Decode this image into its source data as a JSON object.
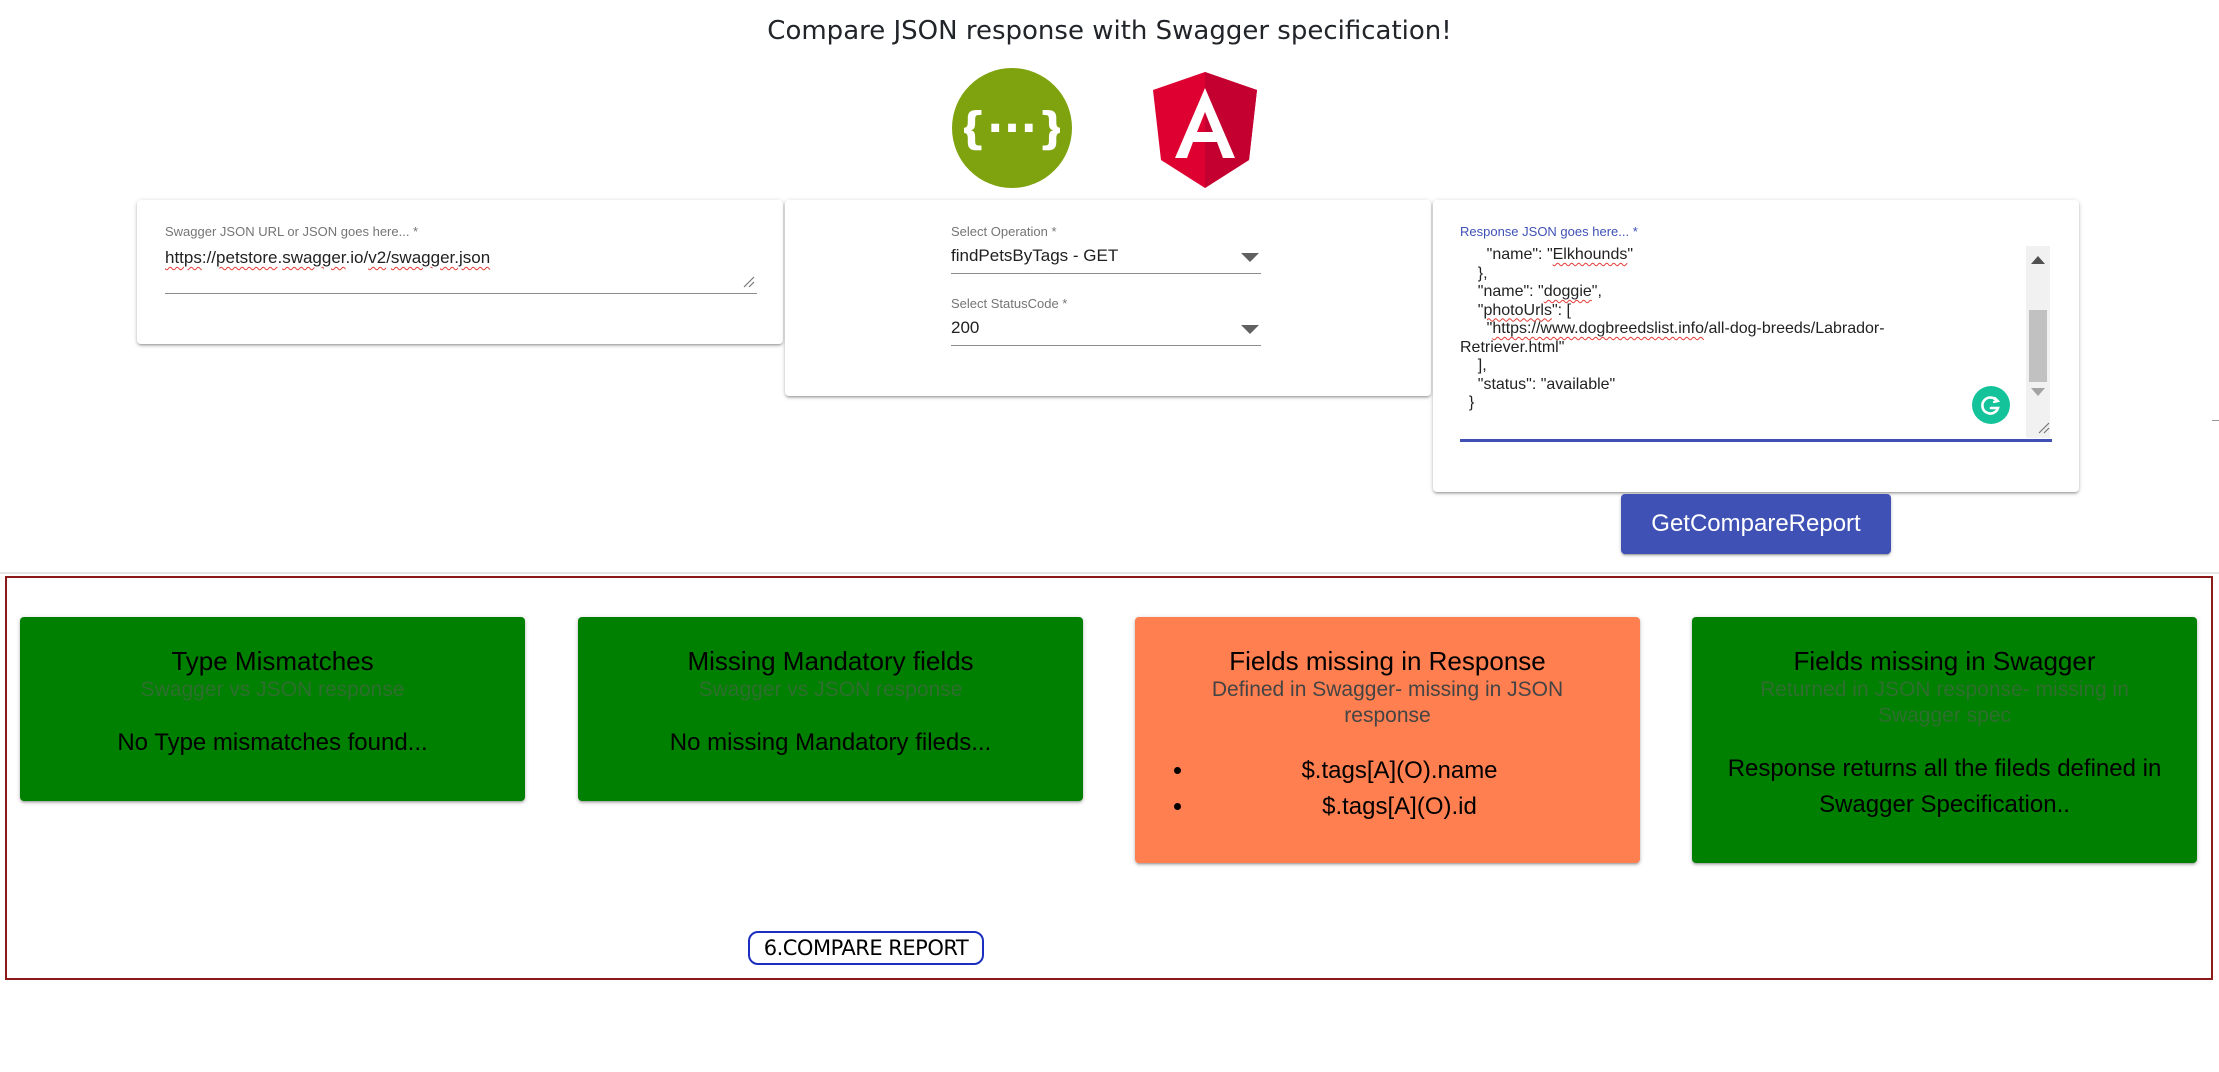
{
  "page": {
    "title": "Compare JSON response with Swagger specification!"
  },
  "logos": {
    "swagger": {
      "icon": "swagger-logo-icon",
      "glyph": "{···}",
      "color": "#7fa30e"
    },
    "angular": {
      "icon": "angular-logo-icon",
      "letter": "A",
      "color": "#dd0031"
    }
  },
  "swagger_input": {
    "label": "Swagger JSON URL or JSON goes here... *",
    "value_parts": [
      "https",
      "://",
      "petstore",
      ".",
      "swagger",
      ".io/",
      "v2",
      "/",
      "swagger.json"
    ]
  },
  "operation_select": {
    "label": "Select Operation *",
    "value": "findPetsByTags - GET"
  },
  "status_select": {
    "label": "Select StatusCode *",
    "value": "200"
  },
  "response_input": {
    "label": "Response JSON goes here... *",
    "lines": [
      "      \"name\": \"Elkhounds\"",
      "    },",
      "    \"name\": \"doggie\",",
      "    \"photoUrls\": [",
      "      \"https://www.dogbreedslist.info/all-dog-breeds/Labrador-",
      "Retriever.html\"",
      "    ],",
      "    \"status\": \"available\"",
      "  }"
    ],
    "accent_color": "#3f51b5"
  },
  "actions": {
    "compare_label": "GetCompareReport"
  },
  "report": {
    "cards": [
      {
        "title": "Type Mismatches",
        "subtitle": "Swagger vs JSON response",
        "message": "No Type mismatches found...",
        "status": "ok"
      },
      {
        "title": "Missing Mandatory fields",
        "subtitle": "Swagger vs JSON response",
        "message": "No missing Mandatory fileds...",
        "status": "ok"
      },
      {
        "title": "Fields missing in Response",
        "subtitle": "Defined in Swagger- missing in JSON response",
        "items": [
          "$.tags[A](O).name",
          "$.tags[A](O).id"
        ],
        "status": "fail"
      },
      {
        "title": "Fields missing in Swagger",
        "subtitle": "Returned in JSON response- missing in Swagger spec",
        "message": "Response returns all the fileds defined in Swagger Specification..",
        "status": "ok"
      }
    ],
    "colors": {
      "ok": "#008000",
      "fail": "#ff7f50",
      "frame": "#8b1a1a"
    }
  },
  "annotation": {
    "label": "6.COMPARE REPORT"
  }
}
